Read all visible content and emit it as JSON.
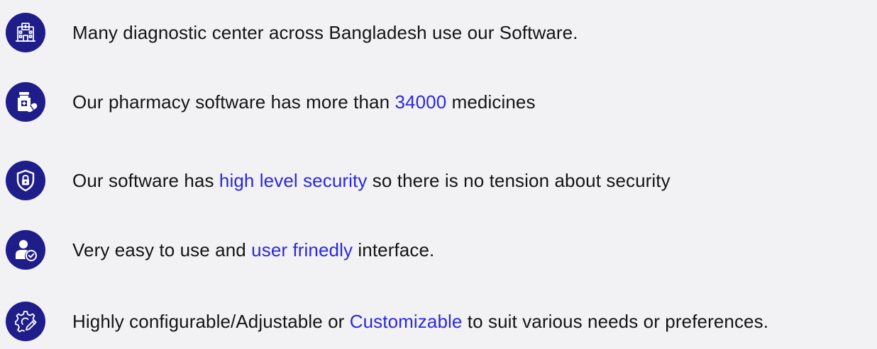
{
  "colors": {
    "icon_background": "#1f1d8a",
    "text": "#141414",
    "highlight": "#2b27e0",
    "page_background": "#f2f2f4"
  },
  "features": [
    {
      "icon": "hospital-icon",
      "before": "Many diagnostic center across Bangladesh use our Software.",
      "highlight": "",
      "after": ""
    },
    {
      "icon": "medicine-bottle-icon",
      "before": "Our pharmacy software has more than ",
      "highlight": "34000",
      "after": " medicines"
    },
    {
      "icon": "shield-lock-icon",
      "before": "Our software has ",
      "highlight": "high level security",
      "after": " so there is no tension about security"
    },
    {
      "icon": "user-check-icon",
      "before": "Very easy to use and ",
      "highlight": "user frinedly",
      "after": " interface."
    },
    {
      "icon": "gear-pencil-icon",
      "before": "Highly configurable/Adjustable or ",
      "highlight": "Customizable",
      "after": " to suit various needs or preferences."
    }
  ]
}
